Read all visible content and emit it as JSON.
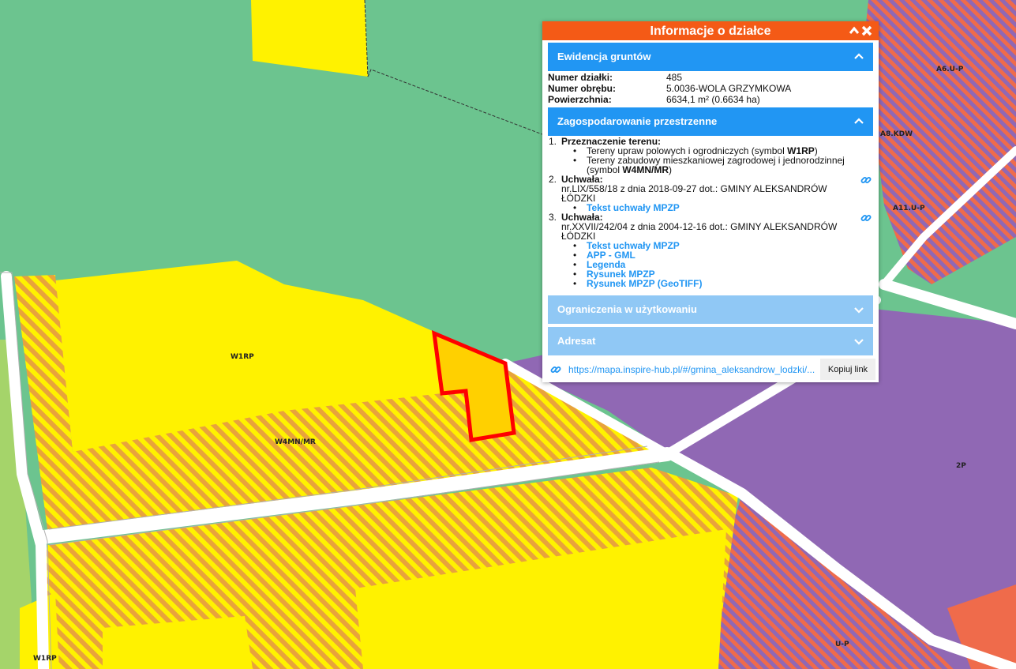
{
  "map": {
    "labels": {
      "w1rp_main": "W1RP",
      "w1rp_corner": "W1RP",
      "w4mn_mr": "W4MN/MR",
      "zone_2p": "2P",
      "zone_up": "U-P",
      "a6_up": "A6.U-P",
      "a8_kdw": "A8.KDW",
      "a11_up": "A11.U-P"
    },
    "colors": {
      "green_zone": "#6cc48f",
      "yellow_zone": "#fff200",
      "hatch_orange": "#e8a33c",
      "purple_zone": "#9068b4",
      "hatch_red": "#ef6b4b",
      "road": "#ffffff",
      "selected_parcel_outline": "#ff0000",
      "light_green": "#a5d46a"
    }
  },
  "panel": {
    "title": "Informacje o działce",
    "header_color": "#f45a16",
    "ewidencja": {
      "title": "Ewidencja gruntów",
      "rows": [
        {
          "label": "Numer działki:",
          "value": "485"
        },
        {
          "label": "Numer obrębu:",
          "value": "5.0036-WOLA GRZYMKOWA"
        },
        {
          "label": "Powierzchnia:",
          "value": "6634,1 m² (0.6634 ha)"
        }
      ]
    },
    "zagospodarowanie": {
      "title": "Zagospodarowanie przestrzenne",
      "item1": {
        "num": "1.",
        "heading": "Przeznaczenie terenu:",
        "b1_text": "Tereny upraw polowych i ogrodniczych (symbol ",
        "b1_symbol": "W1RP",
        "b1_close": ")",
        "b2_text": "Tereny zabudowy mieszkaniowej zagrodowej i jednorodzinnej (symbol ",
        "b2_symbol": "W4MN/MR",
        "b2_close": ")"
      },
      "item2": {
        "num": "2.",
        "heading": "Uchwała:",
        "desc": "nr.LIX/558/18 z dnia 2018-09-27 dot.: GMINY ALEKSANDRÓW ŁÓDZKI",
        "links": [
          "Tekst uchwały MPZP"
        ]
      },
      "item3": {
        "num": "3.",
        "heading": "Uchwała:",
        "desc": "nr.XXVII/242/04 z dnia 2004-12-16 dot.: GMINY ALEKSANDRÓW ŁÓDZKI",
        "links": [
          "Tekst uchwały MPZP",
          "APP - GML",
          "Legenda",
          "Rysunek MPZP",
          "Rysunek MPZP (GeoTIFF)"
        ]
      }
    },
    "ograniczenia": {
      "title": "Ograniczenia w użytkowaniu"
    },
    "adresat": {
      "title": "Adresat"
    },
    "share": {
      "url": "https://mapa.inspire-hub.pl/#/gmina_aleksandrow_lodzki/...",
      "copy_label": "Kopiuj link"
    }
  }
}
